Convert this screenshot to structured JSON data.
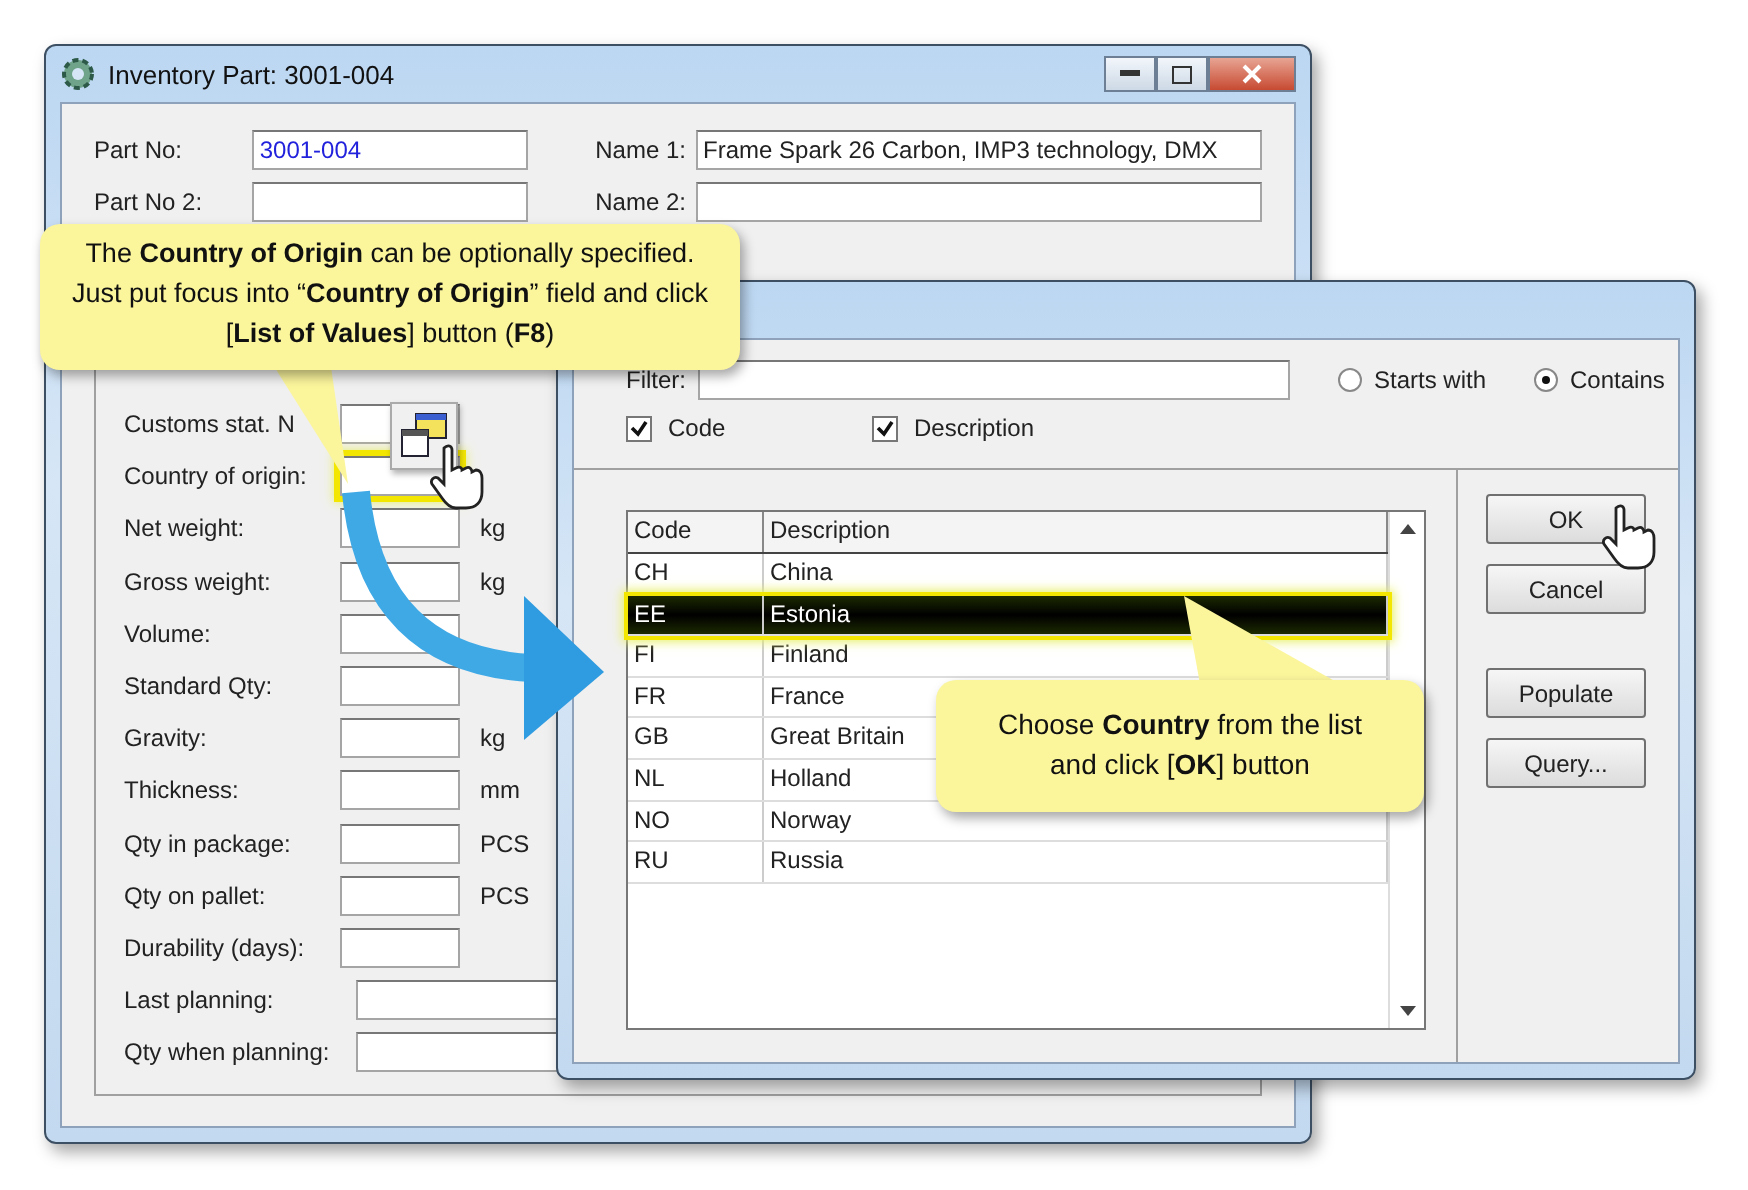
{
  "main_window": {
    "title": "Inventory Part: 3001-004",
    "part_no": {
      "label": "Part No:",
      "value": "3001-004"
    },
    "part_no_2": {
      "label": "Part No 2:"
    },
    "name_1": {
      "label": "Name 1:",
      "value": "Frame Spark 26 Carbon, IMP3 technology, DMX"
    },
    "name_2": {
      "label": "Name 2:"
    },
    "fields": [
      {
        "label": "Customs stat. N",
        "highlighted": false
      },
      {
        "label": "Country of origin:",
        "highlighted": true
      },
      {
        "label": "Net weight:",
        "unit": "kg",
        "highlighted": false
      },
      {
        "label": "Gross weight:",
        "unit": "kg",
        "highlighted": false
      },
      {
        "label": "Volume:",
        "highlighted": false
      },
      {
        "label": "Standard Qty:",
        "highlighted": false
      },
      {
        "label": "Gravity:",
        "unit": "kg",
        "highlighted": false
      },
      {
        "label": "Thickness:",
        "unit": "mm",
        "highlighted": false
      },
      {
        "label": "Qty in package:",
        "unit": "PCS",
        "highlighted": false
      },
      {
        "label": "Qty on pallet:",
        "unit": "PCS",
        "highlighted": false
      },
      {
        "label": "Durability (days):",
        "highlighted": false
      }
    ],
    "planning_fields": [
      {
        "label": "Last planning:"
      },
      {
        "label": "Qty when planning:"
      }
    ]
  },
  "lov_dialog": {
    "filter": {
      "label": "Filter:"
    },
    "match_options": [
      {
        "label": "Starts with",
        "selected": false
      },
      {
        "label": "Contains",
        "selected": true
      }
    ],
    "show_columns": [
      {
        "label": "Code",
        "checked": true
      },
      {
        "label": "Description",
        "checked": true
      }
    ],
    "table": {
      "columns": [
        "Code",
        "Description"
      ],
      "rows": [
        {
          "code": "CH",
          "description": "China",
          "selected": false
        },
        {
          "code": "EE",
          "description": "Estonia",
          "selected": true
        },
        {
          "code": "FI",
          "description": "Finland",
          "selected": false
        },
        {
          "code": "FR",
          "description": "France",
          "selected": false
        },
        {
          "code": "GB",
          "description": "Great Britain",
          "selected": false
        },
        {
          "code": "NL",
          "description": "Holland",
          "selected": false
        },
        {
          "code": "NO",
          "description": "Norway",
          "selected": false
        },
        {
          "code": "RU",
          "description": "Russia",
          "selected": false
        }
      ]
    },
    "buttons": [
      "OK",
      "Cancel",
      "Populate",
      "Query..."
    ]
  },
  "callouts": [
    {
      "text": "The **Country of Origin** can be optionally specified. Just put focus into “**Country of Origin**” field and click [**List of Values**] button (**F8**)"
    },
    {
      "text": "Choose **Country** from the list and click [**OK**] button"
    }
  ]
}
